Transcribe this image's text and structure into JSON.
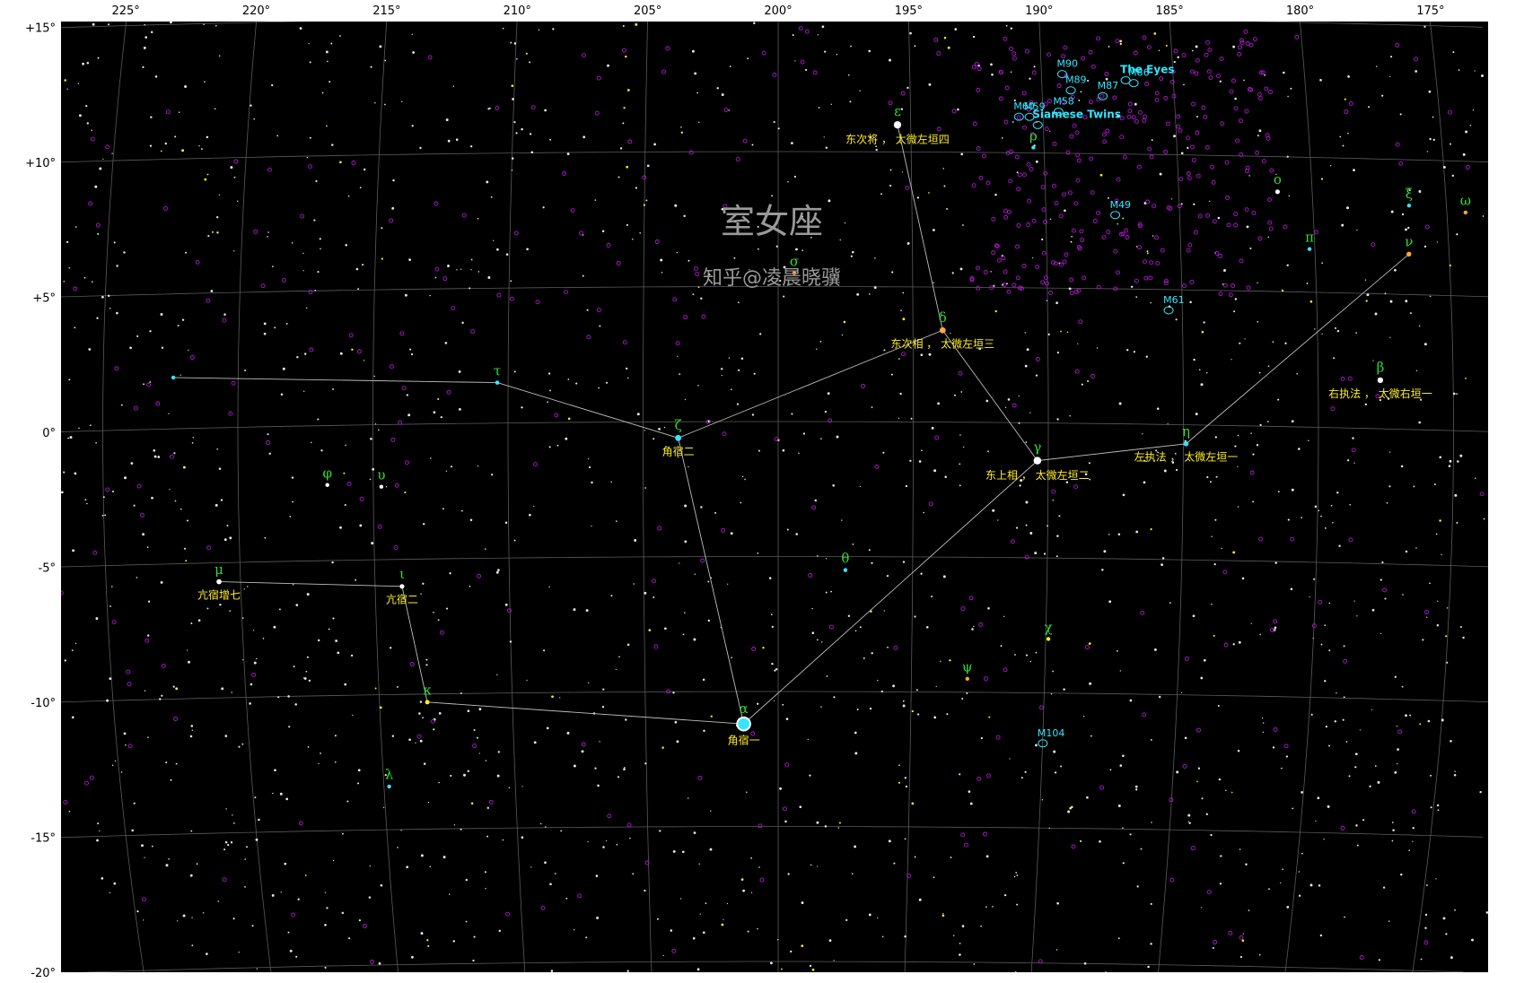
{
  "chart_data": {
    "type": "star-map",
    "title": "室女座",
    "watermark": "知乎@凌晨晓骥",
    "ra_ticks": [
      "225°",
      "220°",
      "215°",
      "210°",
      "205°",
      "200°",
      "195°",
      "190°",
      "185°",
      "180°",
      "175°"
    ],
    "dec_ticks": [
      "+15°",
      "+10°",
      "+5°",
      "0°",
      "-5°",
      "-10°",
      "-15°",
      "-20°"
    ],
    "ra_range": [
      227,
      174
    ],
    "dec_range": [
      -20.5,
      15
    ],
    "stars": [
      {
        "id": "alpha",
        "greek": "α",
        "ra": 201.3,
        "dec": -11.2,
        "mag": 1.0,
        "color": "#33e5ff",
        "label": "角宿一"
      },
      {
        "id": "beta",
        "greek": "β",
        "ra": 177.7,
        "dec": 1.8,
        "mag": 3.6,
        "color": "#ffffff",
        "label": "右执法 ， 太微右垣一"
      },
      {
        "id": "gamma",
        "greek": "γ",
        "ra": 190.4,
        "dec": -1.4,
        "mag": 2.7,
        "color": "#ffffff",
        "label": "东上相 ， 太微左垣二"
      },
      {
        "id": "delta",
        "greek": "δ",
        "ra": 193.9,
        "dec": 3.4,
        "mag": 3.4,
        "color": "#ffaa33",
        "label": "东次相 ， 太微左垣三"
      },
      {
        "id": "epsilon",
        "greek": "ε",
        "ra": 195.5,
        "dec": 11.0,
        "mag": 2.8,
        "color": "#ffffff",
        "label": "东次将 ， 太微左垣四"
      },
      {
        "id": "zeta",
        "greek": "ζ",
        "ra": 203.7,
        "dec": -0.6,
        "mag": 3.4,
        "color": "#33e5ff",
        "label": "角宿二"
      },
      {
        "id": "eta",
        "greek": "η",
        "ra": 184.9,
        "dec": -0.7,
        "mag": 3.9,
        "color": "#33e5ff",
        "label": "左执法 ， 太微左垣一"
      },
      {
        "id": "theta",
        "greek": "θ",
        "ra": 197.5,
        "dec": -5.5,
        "mag": 4.4,
        "color": "#33e5ff",
        "label": ""
      },
      {
        "id": "iota",
        "greek": "ι",
        "ra": 214.0,
        "dec": -6.0,
        "mag": 4.1,
        "color": "#ffffff",
        "label": "亢宿二"
      },
      {
        "id": "kappa",
        "greek": "κ",
        "ra": 213.2,
        "dec": -10.3,
        "mag": 4.2,
        "color": "#ffee22",
        "label": ""
      },
      {
        "id": "lambda",
        "greek": "λ",
        "ra": 214.8,
        "dec": -13.4,
        "mag": 4.5,
        "color": "#33e5ff",
        "label": ""
      },
      {
        "id": "mu",
        "greek": "μ",
        "ra": 220.8,
        "dec": -5.7,
        "mag": 3.9,
        "color": "#ffffff",
        "label": "亢宿增七"
      },
      {
        "id": "nu",
        "greek": "ν",
        "ra": 176.5,
        "dec": 6.5,
        "mag": 4.0,
        "color": "#ffaa33",
        "label": ""
      },
      {
        "id": "xi",
        "greek": "ξ",
        "ra": 176.4,
        "dec": 8.3,
        "mag": 4.8,
        "color": "#33e5ff",
        "label": ""
      },
      {
        "id": "omicron",
        "greek": "ο",
        "ra": 181.3,
        "dec": 8.7,
        "mag": 4.1,
        "color": "#ffffff",
        "label": ""
      },
      {
        "id": "pi",
        "greek": "π",
        "ra": 180.2,
        "dec": 6.6,
        "mag": 4.7,
        "color": "#33e5ff",
        "label": ""
      },
      {
        "id": "rho",
        "greek": "ρ",
        "ra": 190.4,
        "dec": 10.2,
        "mag": 4.9,
        "color": "#33e5ff",
        "label": ""
      },
      {
        "id": "sigma",
        "greek": "σ",
        "ra": 199.4,
        "dec": 5.5,
        "mag": 4.8,
        "color": "#ffaa33",
        "label": ""
      },
      {
        "id": "tau",
        "greek": "τ",
        "ra": 210.4,
        "dec": 1.5,
        "mag": 4.3,
        "color": "#33e5ff",
        "label": ""
      },
      {
        "id": "upsilon",
        "greek": "υ",
        "ra": 214.7,
        "dec": -2.3,
        "mag": 5.1,
        "color": "#ffffff",
        "label": ""
      },
      {
        "id": "phi",
        "greek": "φ",
        "ra": 216.7,
        "dec": -2.2,
        "mag": 4.8,
        "color": "#ffffff",
        "label": ""
      },
      {
        "id": "chi",
        "greek": "χ",
        "ra": 189.9,
        "dec": -8.0,
        "mag": 4.7,
        "color": "#ffee22",
        "label": ""
      },
      {
        "id": "psi",
        "greek": "ψ",
        "ra": 192.9,
        "dec": -9.5,
        "mag": 4.8,
        "color": "#ffaa33",
        "label": ""
      },
      {
        "id": "omega",
        "greek": "ω",
        "ra": 174.3,
        "dec": 8.1,
        "mag": 5.2,
        "color": "#ffaa33",
        "label": ""
      },
      {
        "id": "boundary-east",
        "greek": "",
        "ra": 222.4,
        "dec": 1.9,
        "mag": 4.4,
        "color": "#33e5ff",
        "label": ""
      }
    ],
    "constellation_lines": [
      [
        "boundary-east",
        "tau"
      ],
      [
        "tau",
        "zeta"
      ],
      [
        "zeta",
        "delta"
      ],
      [
        "delta",
        "epsilon"
      ],
      [
        "delta",
        "gamma"
      ],
      [
        "gamma",
        "eta"
      ],
      [
        "eta",
        "nu"
      ],
      [
        "zeta",
        "alpha"
      ],
      [
        "alpha",
        "gamma"
      ],
      [
        "alpha",
        "kappa"
      ],
      [
        "kappa",
        "iota"
      ],
      [
        "iota",
        "mu"
      ]
    ],
    "dso": [
      {
        "name": "M90",
        "ra": 189.2,
        "dec": 13.2
      },
      {
        "name": "M89",
        "ra": 188.9,
        "dec": 12.6
      },
      {
        "name": "M87",
        "ra": 187.7,
        "dec": 12.4
      },
      {
        "name": "The Eyes",
        "ra": 186.8,
        "dec": 13.0,
        "bold": true
      },
      {
        "name": "M86",
        "ra": 186.5,
        "dec": 12.9
      },
      {
        "name": "M59",
        "ra": 190.5,
        "dec": 11.6
      },
      {
        "name": "M60",
        "ra": 190.9,
        "dec": 11.6
      },
      {
        "name": "M58",
        "ra": 189.4,
        "dec": 11.8
      },
      {
        "name": "Siamese Twins",
        "ra": 190.2,
        "dec": 11.3,
        "bold": true
      },
      {
        "name": "M49",
        "ra": 187.4,
        "dec": 8.0
      },
      {
        "name": "M61",
        "ra": 185.5,
        "dec": 4.5
      },
      {
        "name": "M104",
        "ra": 190.0,
        "dec": -11.6
      }
    ]
  }
}
